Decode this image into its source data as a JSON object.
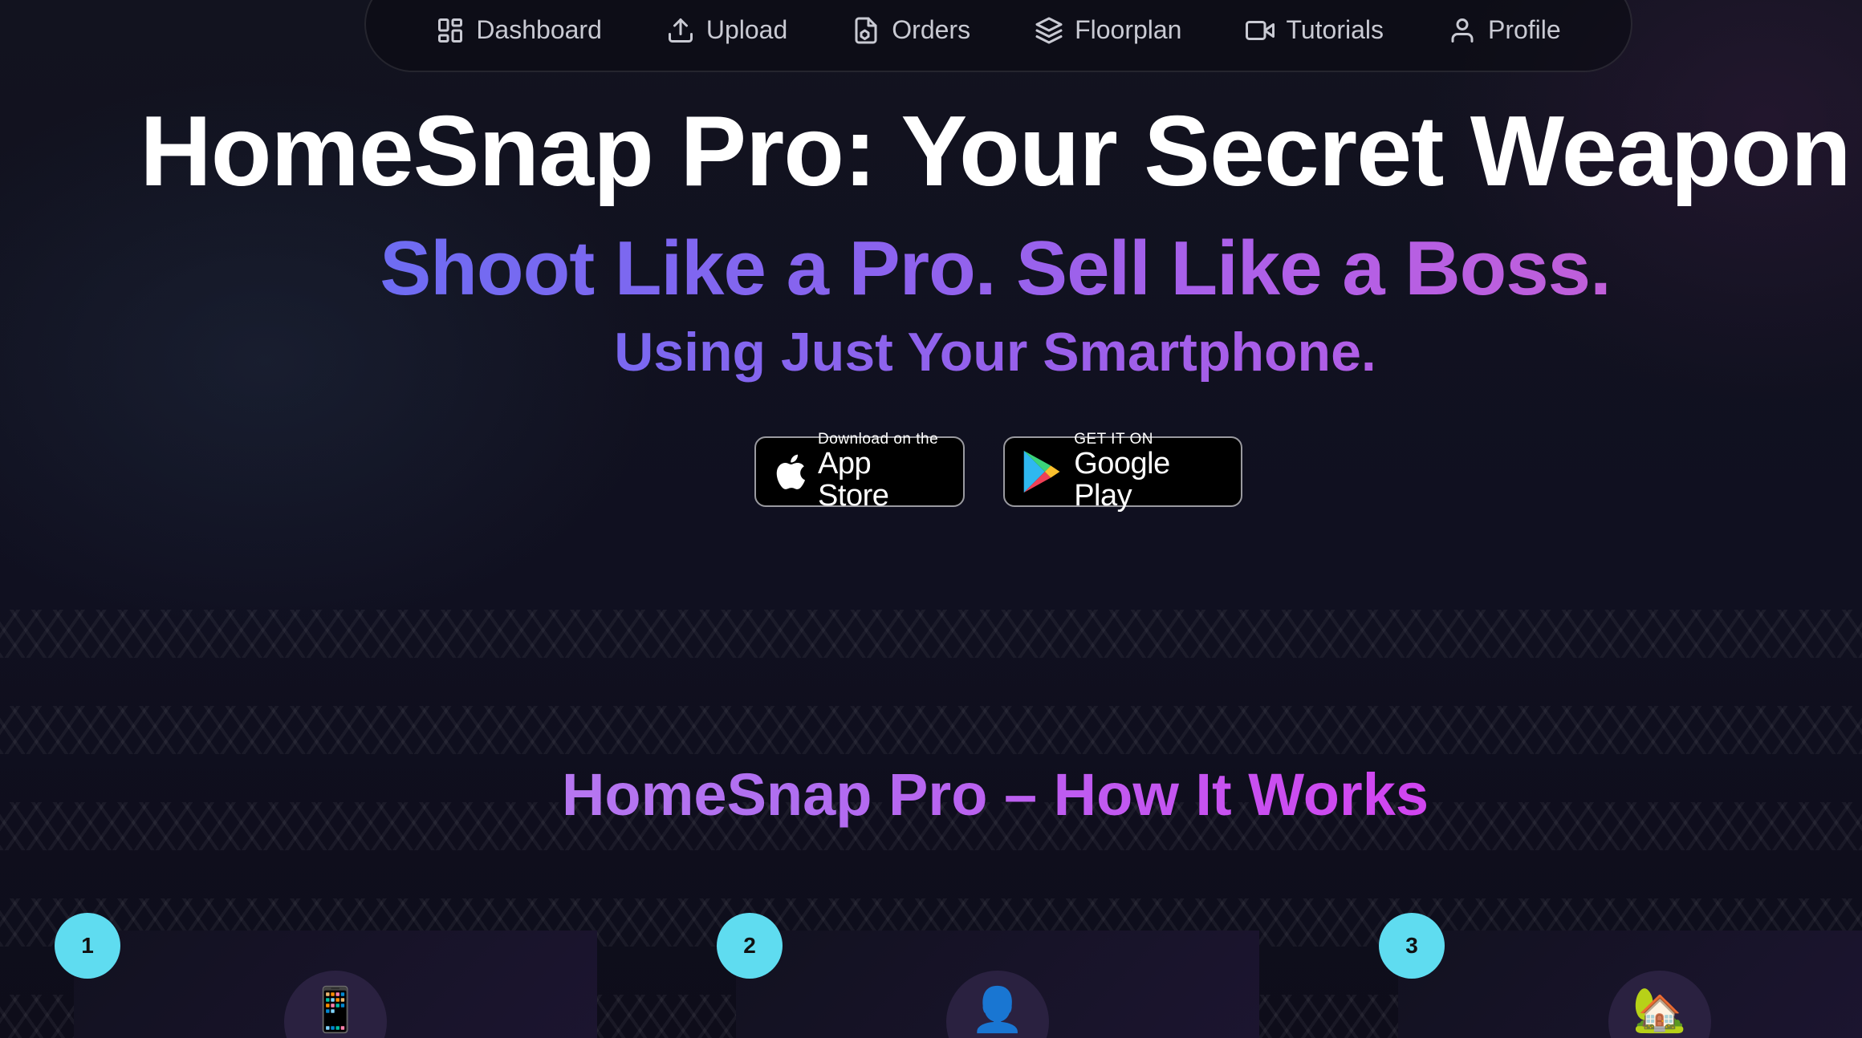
{
  "nav": {
    "items": [
      {
        "label": "Dashboard",
        "icon": "dashboard-icon"
      },
      {
        "label": "Upload",
        "icon": "upload-icon"
      },
      {
        "label": "Orders",
        "icon": "orders-icon"
      },
      {
        "label": "Floorplan",
        "icon": "layers-icon"
      },
      {
        "label": "Tutorials",
        "icon": "video-icon"
      },
      {
        "label": "Profile",
        "icon": "user-icon"
      }
    ]
  },
  "hero": {
    "title": "HomeSnap Pro: Your Secret Weapon",
    "subtitle": "Shoot Like a Pro. Sell Like a Boss.",
    "subtitle2": "Using Just Your Smartphone."
  },
  "stores": {
    "apple": {
      "small": "Download on the",
      "big": "App Store"
    },
    "google": {
      "small": "GET IT ON",
      "big": "Google Play"
    }
  },
  "how": {
    "title": "HomeSnap Pro – How It Works",
    "steps": [
      {
        "number": "1",
        "icon": "📱"
      },
      {
        "number": "2",
        "icon": "👤"
      },
      {
        "number": "3",
        "icon": "🏡"
      }
    ]
  },
  "colors": {
    "background": "#0f0e1a",
    "accent_cyan": "#5fdcf0",
    "accent_purple": "#8a63ee",
    "accent_magenta": "#d046f0"
  }
}
